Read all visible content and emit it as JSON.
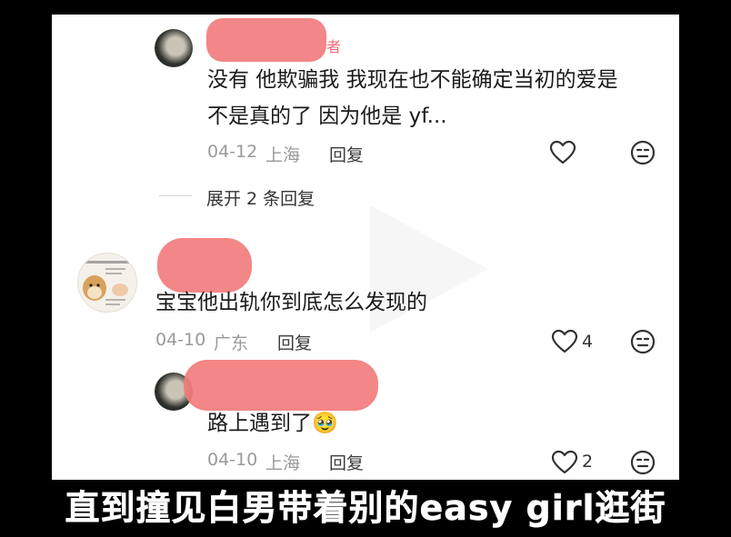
{
  "comments": [
    {
      "author_tag": "者",
      "text_lines": [
        "没有 他欺骗我 我现在也不能确定当初的爱是",
        "不是真的了 因为他是 yf..."
      ],
      "date": "04-12",
      "location": "上海",
      "reply_label": "回复",
      "likes": ""
    },
    {
      "text_lines": [
        "宝宝他出轨你到底怎么发现的"
      ],
      "date": "04-10",
      "location": "广东",
      "reply_label": "回复",
      "likes": "4"
    },
    {
      "text_lines": [
        "路上遇到了🥹"
      ],
      "date": "04-10",
      "location": "上海",
      "reply_label": "回复",
      "likes": "2"
    }
  ],
  "expand_label": "展开 2 条回复",
  "caption": "直到撞见白男带着别的easy girl逛街",
  "icons": {
    "like": "heart-outline-icon",
    "dislike": "neutral-face-icon",
    "play": "play-icon"
  },
  "colors": {
    "redaction": "#f27c7c",
    "author_tag": "#f06b7a"
  }
}
